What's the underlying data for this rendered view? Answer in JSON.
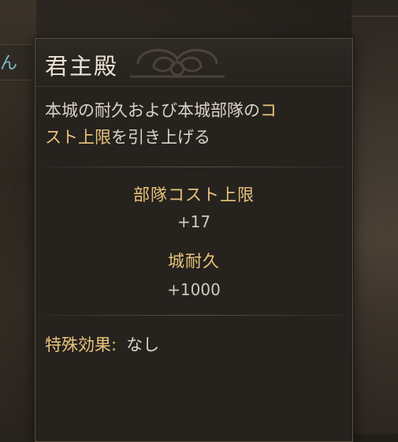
{
  "background": {
    "left_partial_text": "ん"
  },
  "tooltip": {
    "title": "君主殿",
    "description": {
      "part1": "本城の耐久および本城部隊の",
      "highlight1": "コ",
      "break": "",
      "highlight2": "スト上限",
      "part2": "を引き上げる"
    },
    "stats": [
      {
        "label": "部隊コスト上限",
        "value": "+17"
      },
      {
        "label": "城耐久",
        "value": "+1000"
      }
    ],
    "special": {
      "label": "特殊効果:",
      "value": "なし"
    }
  },
  "colors": {
    "highlight": "#e8c47a",
    "text": "#d9d2c6",
    "panel": "#26221e"
  },
  "icons": [
    "crest-icon"
  ]
}
